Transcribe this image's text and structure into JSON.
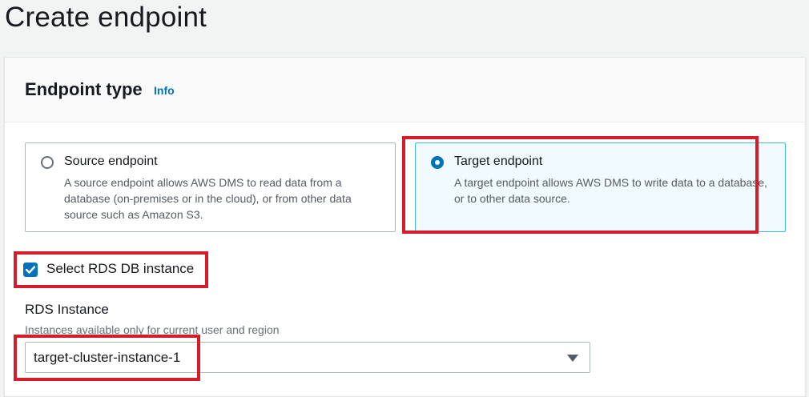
{
  "page": {
    "title": "Create endpoint"
  },
  "section": {
    "title": "Endpoint type",
    "info": "Info"
  },
  "endpoint_options": [
    {
      "title": "Source endpoint",
      "description": "A source endpoint allows AWS DMS to read data from a database (on-premises or in the cloud), or from other data source such as Amazon S3.",
      "selected": false
    },
    {
      "title": "Target endpoint",
      "description": "A target endpoint allows AWS DMS to write data to a database, or to other data source.",
      "selected": true
    }
  ],
  "rds_checkbox": {
    "label": "Select RDS DB instance",
    "checked": true
  },
  "rds_instance": {
    "label": "RDS Instance",
    "description": "Instances available only for current user and region",
    "value": "target-cluster-instance-1"
  },
  "colors": {
    "accent": "#0073bb",
    "highlight": "#d51d2a",
    "selected_tile_bg": "#f1faff"
  }
}
